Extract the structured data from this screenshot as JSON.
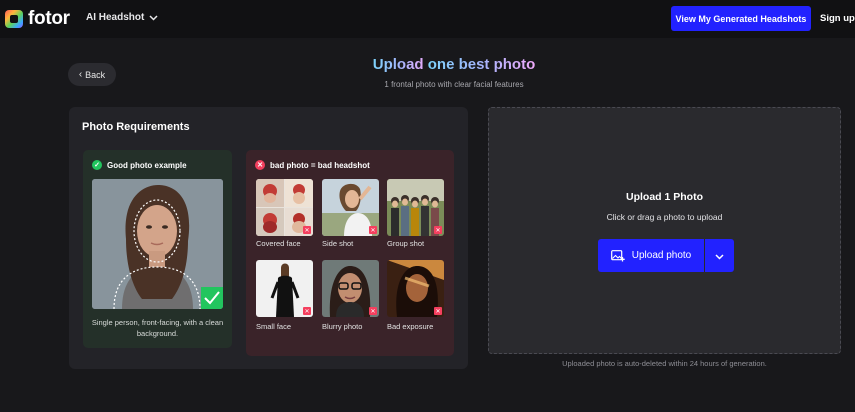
{
  "app": {
    "logo_text": "fotor"
  },
  "nav": {
    "menu_label": "AI Headshot",
    "cta_label": "View My Generated Headshots",
    "signup_label": "Sign up"
  },
  "header": {
    "back_label": "Back",
    "title_prefix": "Upload ",
    "title_highlight": "one best photo",
    "subtitle": "1 frontal photo with clear facial features"
  },
  "requirements": {
    "title": "Photo Requirements",
    "good": {
      "heading": "Good photo example",
      "caption": "Single person, front-facing, with a clean background."
    },
    "bad": {
      "heading": "bad photo = bad headshot",
      "items": [
        {
          "label": "Covered face"
        },
        {
          "label": "Side shot"
        },
        {
          "label": "Group shot"
        },
        {
          "label": "Small face"
        },
        {
          "label": "Blurry photo"
        },
        {
          "label": "Bad exposure"
        }
      ]
    }
  },
  "upload": {
    "title": "Upload 1 Photo",
    "subtitle": "Click or drag a photo to upload",
    "button_label": "Upload photo",
    "note": "Uploaded photo is auto-deleted within 24 hours of generation."
  },
  "colors": {
    "accent": "#2222ff",
    "good": "#22c55e",
    "bad": "#f43f5e"
  }
}
